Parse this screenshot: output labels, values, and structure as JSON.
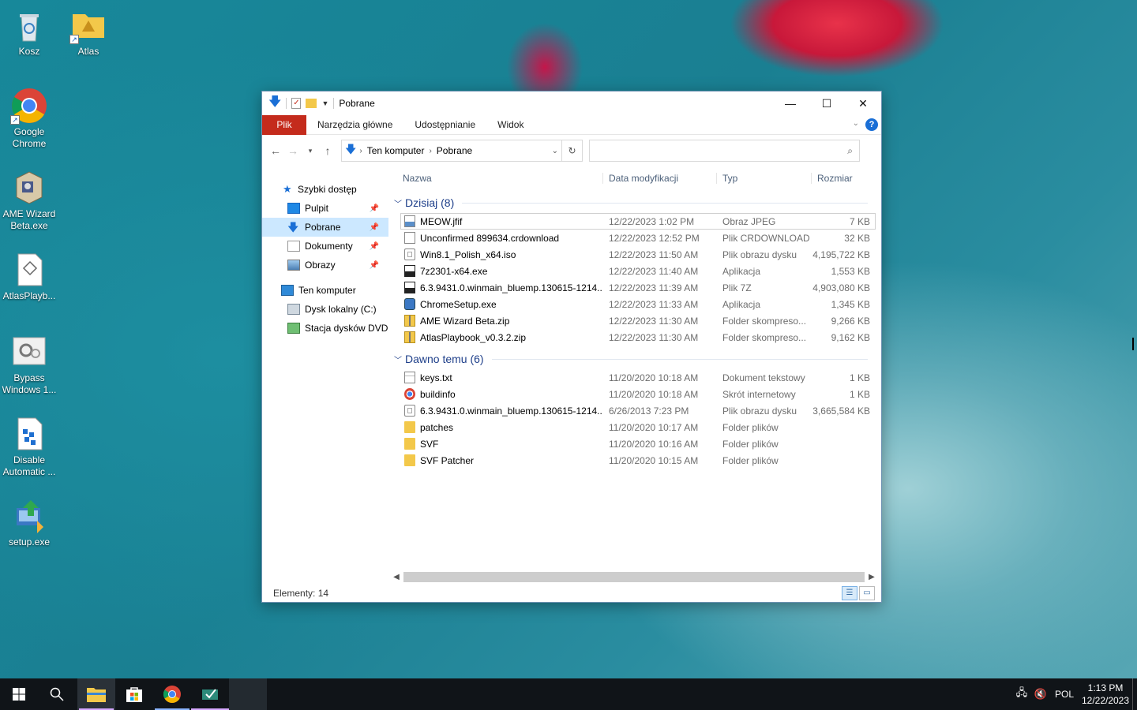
{
  "desktop": {
    "icons": [
      {
        "label": "Kosz",
        "icon": "recycle-bin-icon"
      },
      {
        "label": "Atlas",
        "icon": "folder-icon"
      },
      {
        "label": "Google Chrome",
        "icon": "chrome-icon"
      },
      {
        "label": "AME Wizard Beta.exe",
        "icon": "ame-wizard-icon"
      },
      {
        "label": "AtlasPlayb...",
        "icon": "atlas-playbook-icon"
      },
      {
        "label": "Bypass Windows 1...",
        "icon": "gear-icon"
      },
      {
        "label": "Disable Automatic ...",
        "icon": "script-icon"
      },
      {
        "label": "setup.exe",
        "icon": "setup-icon"
      }
    ]
  },
  "window": {
    "title": "Pobrane",
    "ribbon_tabs": [
      "Plik",
      "Narzędzia główne",
      "Udostępnianie",
      "Widok"
    ],
    "help_label": "?",
    "breadcrumb": [
      "Ten komputer",
      "Pobrane"
    ],
    "search_placeholder": "",
    "nav": {
      "quick_access": "Szybki dostęp",
      "items": [
        {
          "label": "Pulpit",
          "pinned": true
        },
        {
          "label": "Pobrane",
          "pinned": true,
          "selected": true
        },
        {
          "label": "Dokumenty",
          "pinned": true
        },
        {
          "label": "Obrazy",
          "pinned": true
        }
      ],
      "this_pc": "Ten komputer",
      "drives": [
        "Dysk lokalny (C:)",
        "Stacja dysków DVD"
      ]
    },
    "columns": [
      "Nazwa",
      "Data modyfikacji",
      "Typ",
      "Rozmiar"
    ],
    "groups": [
      {
        "title": "Dzisiaj (8)",
        "files": [
          {
            "name": "MEOW.jfif",
            "date": "12/22/2023 1:02 PM",
            "type": "Obraz JPEG",
            "size": "7 KB",
            "icon": "image-file-icon"
          },
          {
            "name": "Unconfirmed 899634.crdownload",
            "date": "12/22/2023 12:52 PM",
            "type": "Plik CRDOWNLOAD",
            "size": "32 KB",
            "icon": "blank-file-icon"
          },
          {
            "name": "Win8.1_Polish_x64.iso",
            "date": "12/22/2023 11:50 AM",
            "type": "Plik obrazu dysku",
            "size": "4,195,722 KB",
            "icon": "disc-image-icon"
          },
          {
            "name": "7z2301-x64.exe",
            "date": "12/22/2023 11:40 AM",
            "type": "Aplikacja",
            "size": "1,553 KB",
            "icon": "7zip-icon"
          },
          {
            "name": "6.3.9431.0.winmain_bluemp.130615-1214...",
            "date": "12/22/2023 11:39 AM",
            "type": "Plik 7Z",
            "size": "4,903,080 KB",
            "icon": "7zip-icon"
          },
          {
            "name": "ChromeSetup.exe",
            "date": "12/22/2023 11:33 AM",
            "type": "Aplikacja",
            "size": "1,345 KB",
            "icon": "installer-icon"
          },
          {
            "name": "AME Wizard Beta.zip",
            "date": "12/22/2023 11:30 AM",
            "type": "Folder skompreso...",
            "size": "9,266 KB",
            "icon": "zip-folder-icon"
          },
          {
            "name": "AtlasPlaybook_v0.3.2.zip",
            "date": "12/22/2023 11:30 AM",
            "type": "Folder skompreso...",
            "size": "9,162 KB",
            "icon": "zip-folder-icon"
          }
        ]
      },
      {
        "title": "Dawno temu (6)",
        "files": [
          {
            "name": "keys.txt",
            "date": "11/20/2020 10:18 AM",
            "type": "Dokument tekstowy",
            "size": "1 KB",
            "icon": "text-file-icon"
          },
          {
            "name": "buildinfo",
            "date": "11/20/2020 10:18 AM",
            "type": "Skrót internetowy",
            "size": "1 KB",
            "icon": "chrome-icon"
          },
          {
            "name": "6.3.9431.0.winmain_bluemp.130615-1214...",
            "date": "6/26/2013 7:23 PM",
            "type": "Plik obrazu dysku",
            "size": "3,665,584 KB",
            "icon": "disc-image-icon"
          },
          {
            "name": "patches",
            "date": "11/20/2020 10:17 AM",
            "type": "Folder plików",
            "size": "",
            "icon": "folder-icon"
          },
          {
            "name": "SVF",
            "date": "11/20/2020 10:16 AM",
            "type": "Folder plików",
            "size": "",
            "icon": "folder-icon"
          },
          {
            "name": "SVF Patcher",
            "date": "11/20/2020 10:15 AM",
            "type": "Folder plików",
            "size": "",
            "icon": "folder-icon"
          }
        ]
      }
    ],
    "status": "Elementy: 14"
  },
  "taskbar": {
    "apps": [
      "start-icon",
      "search-icon",
      "file-explorer-icon",
      "store-icon",
      "chrome-icon",
      "ame-icon"
    ],
    "tray": {
      "language": "POL",
      "time": "1:13 PM",
      "date": "12/22/2023"
    }
  },
  "colors": {
    "accent": "#c42b1c",
    "selection": "#cce8ff",
    "group_header": "#1e3f8a",
    "folder": "#f3c84a"
  }
}
